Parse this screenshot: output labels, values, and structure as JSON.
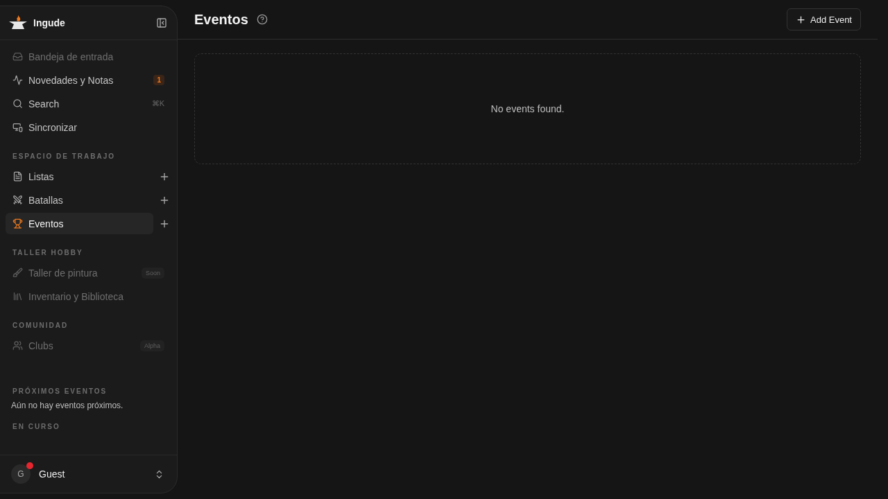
{
  "sidebar": {
    "brand": "Ingude",
    "top_items": [
      {
        "label": "Bandeja de entrada",
        "disabled": true,
        "selected": false
      },
      {
        "label": "Novedades y Notas",
        "disabled": false,
        "selected": false,
        "trailing": {
          "kind": "count",
          "text": "1"
        }
      },
      {
        "label": "Search",
        "disabled": false,
        "selected": false,
        "trailing": {
          "kind": "shortcut",
          "text": "⌘K"
        }
      },
      {
        "label": "Sincronizar",
        "disabled": false,
        "selected": false
      }
    ],
    "sections": [
      {
        "title": "ESPACIO DE TRABAJO",
        "items": [
          {
            "label": "Listas",
            "disabled": false,
            "selected": false,
            "add": true
          },
          {
            "label": "Batallas",
            "disabled": false,
            "selected": false,
            "add": true
          },
          {
            "label": "Eventos",
            "disabled": false,
            "selected": true,
            "add": true
          }
        ]
      },
      {
        "title": "TALLER HOBBY",
        "items": [
          {
            "label": "Taller de pintura",
            "disabled": true,
            "selected": false,
            "trailing": {
              "kind": "tag",
              "text": "Soon"
            }
          },
          {
            "label": "Inventario y Biblioteca",
            "disabled": true,
            "selected": false
          }
        ]
      },
      {
        "title": "COMUNIDAD",
        "items": [
          {
            "label": "Clubs",
            "disabled": true,
            "selected": false,
            "trailing": {
              "kind": "tag",
              "text": "Alpha"
            }
          }
        ]
      }
    ],
    "upcoming": {
      "title": "PRÓXIMOS EVENTOS",
      "text": "Aún no hay eventos próximos."
    },
    "ongoing": {
      "title": "EN CURSO"
    },
    "user": {
      "initial": "G",
      "name": "Guest",
      "notification": true
    }
  },
  "header": {
    "title": "Eventos",
    "button": "Add Event"
  },
  "empty_state": "No events found."
}
